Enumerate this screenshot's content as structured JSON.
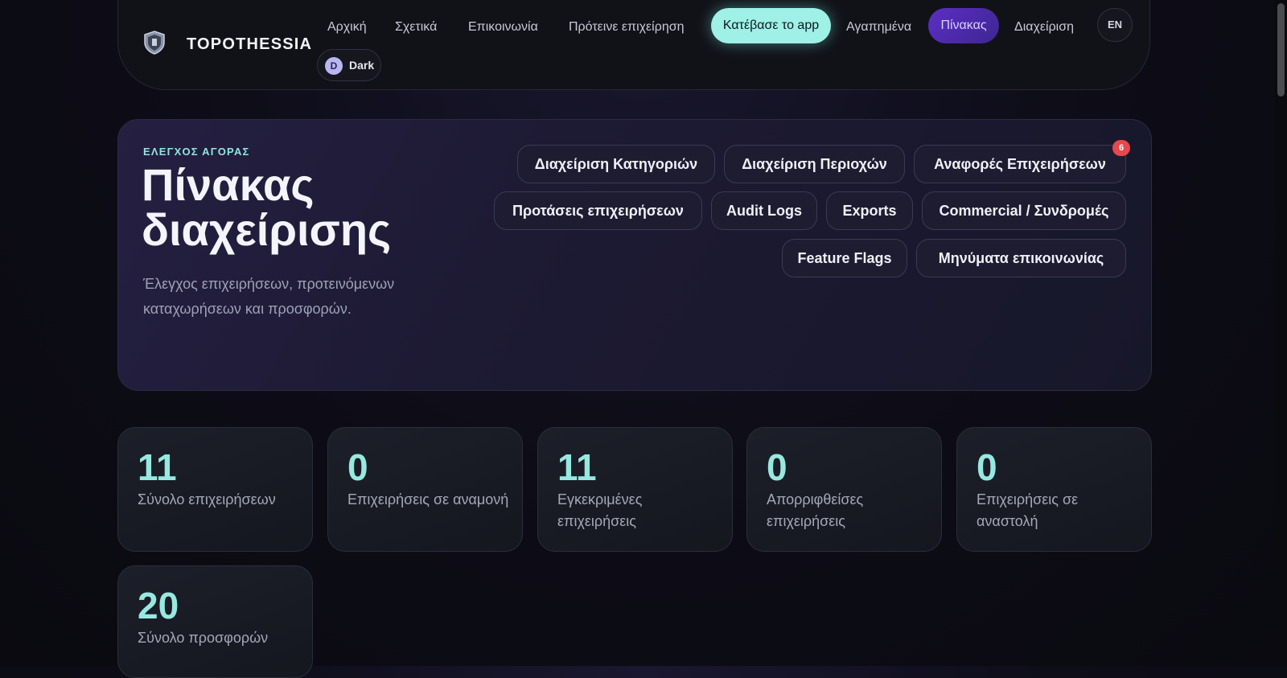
{
  "brand": {
    "name": "TOPOTHESSIA"
  },
  "nav": {
    "home": "Αρχική",
    "about": "Σχετικά",
    "contact": "Επικοινωνία",
    "suggest": "Πρότεινε επιχείρηση",
    "download": "Κατέβασε το app",
    "favorites": "Αγαπημένα",
    "dashboard": "Πίνακας",
    "admin": "Διαχείριση",
    "language": "EN",
    "theme_initial": "D",
    "theme_label": "Dark"
  },
  "hero": {
    "eyebrow": "ΕΛΕΓΧΟΣ ΑΓΟΡΑΣ",
    "title": "Πίνακας διαχείρισης",
    "description": "Έλεγχος επιχειρήσεων, προτεινόμενων καταχωρήσεων και προσφορών."
  },
  "actions": {
    "categories": "Διαχείριση Κατηγοριών",
    "areas": "Διαχείριση Περιοχών",
    "reports": "Αναφορές Επιχειρήσεων",
    "reports_badge": "6",
    "suggestions": "Προτάσεις επιχειρήσεων",
    "audit": "Audit Logs",
    "exports": "Exports",
    "commercial": "Commercial / Συνδρομές",
    "flags": "Feature Flags",
    "messages": "Μηνύματα επικοινωνίας"
  },
  "stats": [
    {
      "value": "11",
      "label": "Σύνολο επιχειρήσεων"
    },
    {
      "value": "0",
      "label": "Επιχειρήσεις σε αναμονή"
    },
    {
      "value": "11",
      "label": "Εγκεκριμένες επιχειρήσεις"
    },
    {
      "value": "0",
      "label": "Απορριφθείσες επιχειρήσεις"
    },
    {
      "value": "0",
      "label": "Επιχειρήσεις σε αναστολή"
    },
    {
      "value": "20",
      "label": "Σύνολο προσφορών"
    }
  ],
  "colors": {
    "accent": "#9ff0e6",
    "active": "#5b2fc4",
    "badge": "#e5484d",
    "stat_value": "#97e8e0"
  }
}
